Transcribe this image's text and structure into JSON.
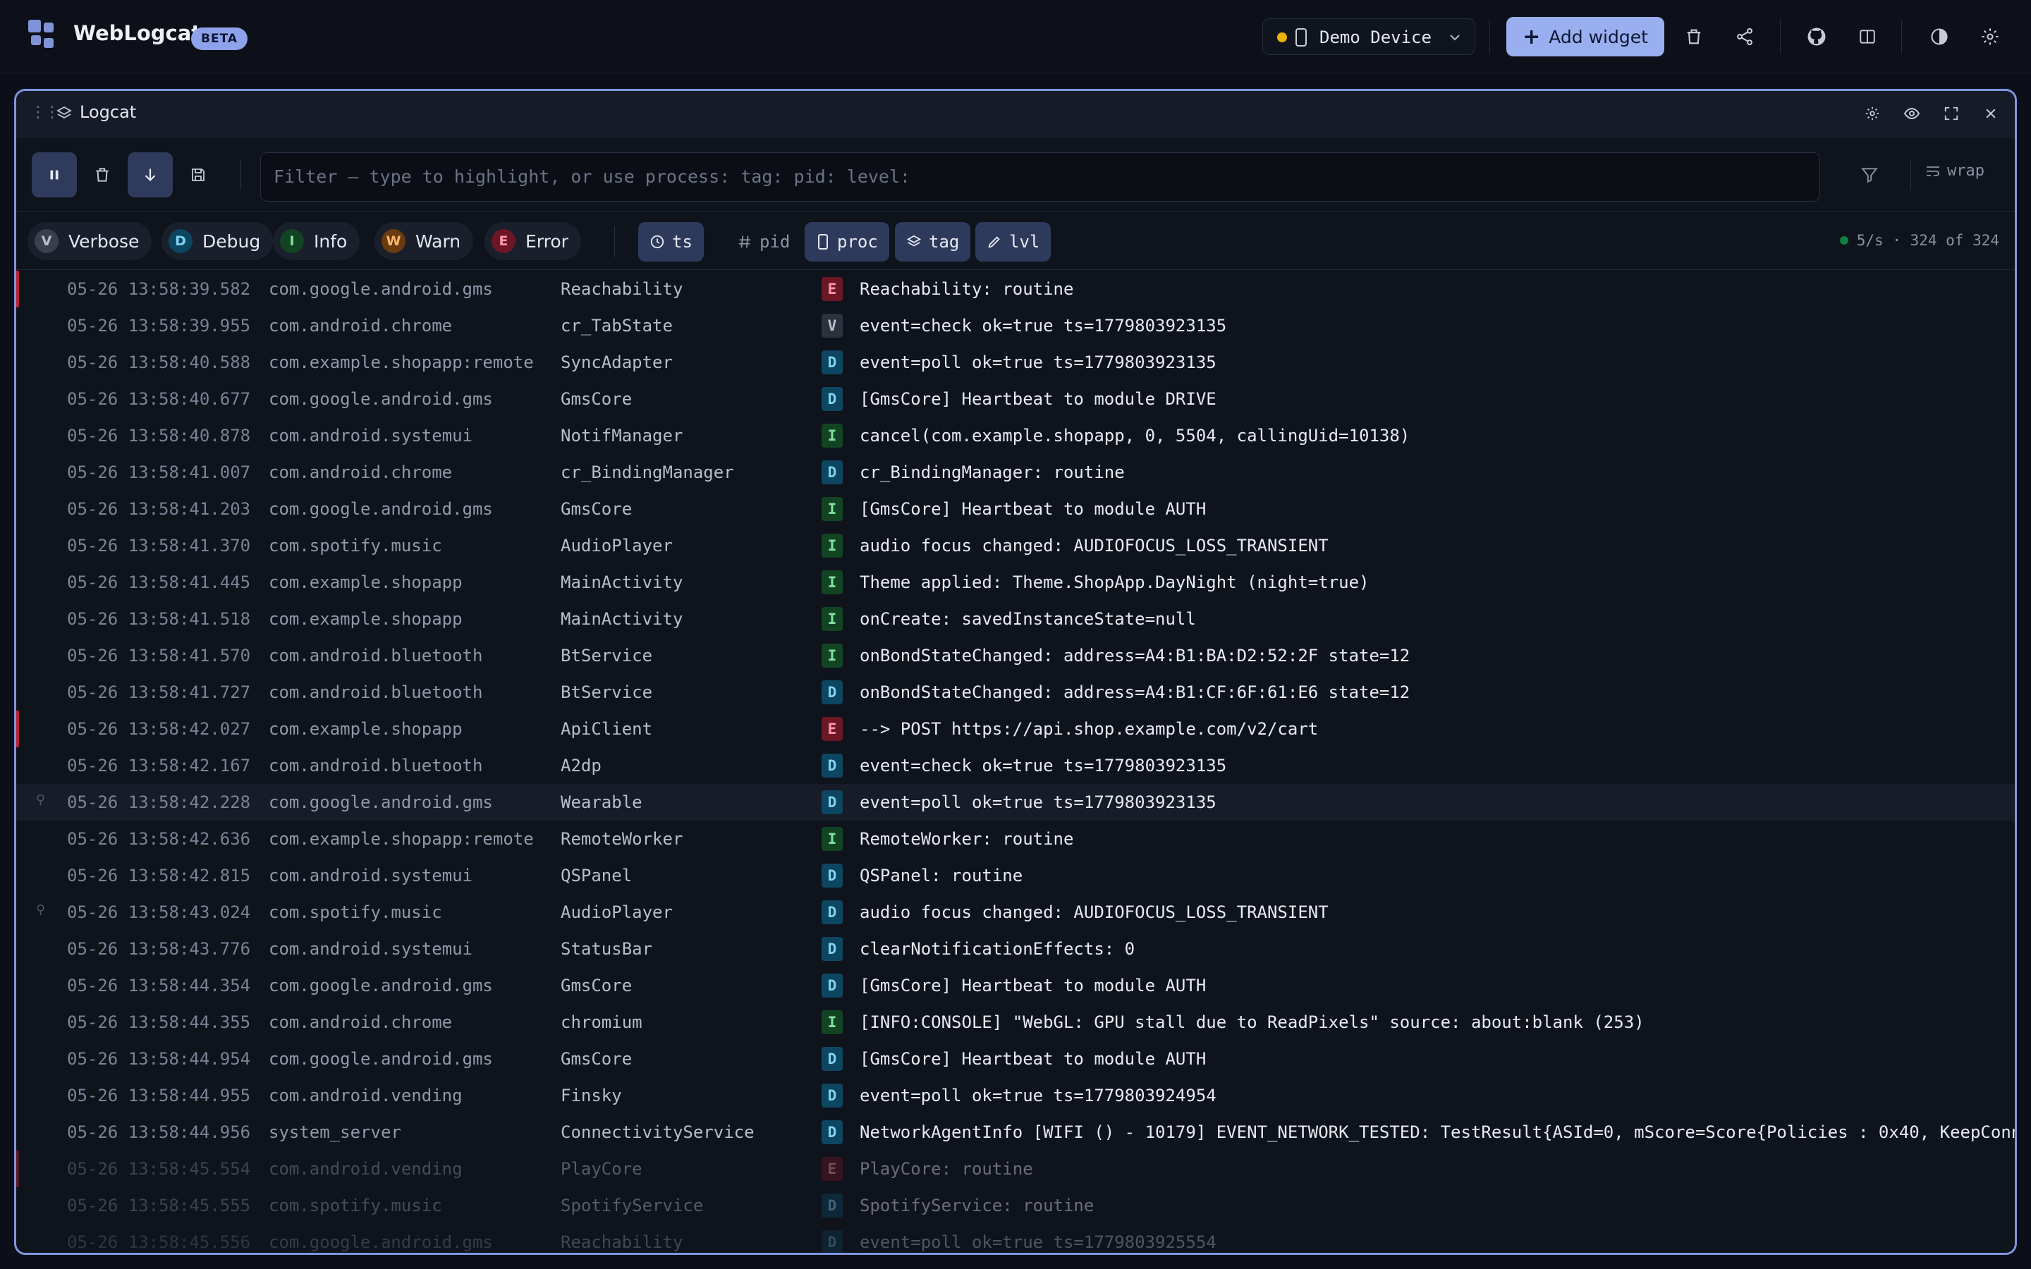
{
  "app": {
    "title": "WebLogcat",
    "badge": "BETA"
  },
  "header": {
    "device_label": "Demo Device",
    "add_widget_label": "Add widget",
    "icons": [
      "trash-icon",
      "share-icon",
      "github-icon",
      "layout-icon",
      "contrast-icon",
      "gear-icon"
    ]
  },
  "panel": {
    "title": "Logcat",
    "filter_placeholder": "Filter — type to highlight, or use  process:  tag:  pid:  level:",
    "wrap_label": "wrap",
    "levels": [
      {
        "letter": "V",
        "label": "Verbose"
      },
      {
        "letter": "D",
        "label": "Debug"
      },
      {
        "letter": "I",
        "label": "Info"
      },
      {
        "letter": "W",
        "label": "Warn"
      },
      {
        "letter": "E",
        "label": "Error"
      }
    ],
    "columns": [
      {
        "label": "ts",
        "active": true
      },
      {
        "label": "pid",
        "active": false
      },
      {
        "label": "proc",
        "active": true
      },
      {
        "label": "tag",
        "active": true
      },
      {
        "label": "lvl",
        "active": true
      }
    ],
    "rate": "5/s · 324 of 324"
  },
  "rows": [
    {
      "ts": "05-26 13:58:39.582",
      "proc": "com.google.android.gms",
      "tag": "Reachability",
      "lvl": "E",
      "msg": "Reachability: routine"
    },
    {
      "ts": "05-26 13:58:39.955",
      "proc": "com.android.chrome",
      "tag": "cr_TabState",
      "lvl": "V",
      "msg": "event=check ok=true ts=1779803923135"
    },
    {
      "ts": "05-26 13:58:40.588",
      "proc": "com.example.shopapp:remote",
      "tag": "SyncAdapter",
      "lvl": "D",
      "msg": "event=poll ok=true ts=1779803923135"
    },
    {
      "ts": "05-26 13:58:40.677",
      "proc": "com.google.android.gms",
      "tag": "GmsCore",
      "lvl": "D",
      "msg": "[GmsCore] Heartbeat to module DRIVE"
    },
    {
      "ts": "05-26 13:58:40.878",
      "proc": "com.android.systemui",
      "tag": "NotifManager",
      "lvl": "I",
      "msg": "cancel(com.example.shopapp, 0, 5504, callingUid=10138)"
    },
    {
      "ts": "05-26 13:58:41.007",
      "proc": "com.android.chrome",
      "tag": "cr_BindingManager",
      "lvl": "D",
      "msg": "cr_BindingManager: routine"
    },
    {
      "ts": "05-26 13:58:41.203",
      "proc": "com.google.android.gms",
      "tag": "GmsCore",
      "lvl": "I",
      "msg": "[GmsCore] Heartbeat to module AUTH"
    },
    {
      "ts": "05-26 13:58:41.370",
      "proc": "com.spotify.music",
      "tag": "AudioPlayer",
      "lvl": "I",
      "msg": "audio focus changed: AUDIOFOCUS_LOSS_TRANSIENT"
    },
    {
      "ts": "05-26 13:58:41.445",
      "proc": "com.example.shopapp",
      "tag": "MainActivity",
      "lvl": "I",
      "msg": "Theme applied: Theme.ShopApp.DayNight (night=true)"
    },
    {
      "ts": "05-26 13:58:41.518",
      "proc": "com.example.shopapp",
      "tag": "MainActivity",
      "lvl": "I",
      "msg": "onCreate: savedInstanceState=null"
    },
    {
      "ts": "05-26 13:58:41.570",
      "proc": "com.android.bluetooth",
      "tag": "BtService",
      "lvl": "I",
      "msg": "onBondStateChanged: address=A4:B1:BA:D2:52:2F state=12"
    },
    {
      "ts": "05-26 13:58:41.727",
      "proc": "com.android.bluetooth",
      "tag": "BtService",
      "lvl": "D",
      "msg": "onBondStateChanged: address=A4:B1:CF:6F:61:E6 state=12"
    },
    {
      "ts": "05-26 13:58:42.027",
      "proc": "com.example.shopapp",
      "tag": "ApiClient",
      "lvl": "E",
      "msg": "--> POST https://api.shop.example.com/v2/cart"
    },
    {
      "ts": "05-26 13:58:42.167",
      "proc": "com.android.bluetooth",
      "tag": "A2dp",
      "lvl": "D",
      "msg": "event=check ok=true ts=1779803923135"
    },
    {
      "ts": "05-26 13:58:42.228",
      "proc": "com.google.android.gms",
      "tag": "Wearable",
      "lvl": "D",
      "msg": "event=poll ok=true ts=1779803923135",
      "highlight": true,
      "pinned": true
    },
    {
      "ts": "05-26 13:58:42.636",
      "proc": "com.example.shopapp:remote",
      "tag": "RemoteWorker",
      "lvl": "I",
      "msg": "RemoteWorker: routine"
    },
    {
      "ts": "05-26 13:58:42.815",
      "proc": "com.android.systemui",
      "tag": "QSPanel",
      "lvl": "D",
      "msg": "QSPanel: routine"
    },
    {
      "ts": "05-26 13:58:43.024",
      "proc": "com.spotify.music",
      "tag": "AudioPlayer",
      "lvl": "D",
      "msg": "audio focus changed: AUDIOFOCUS_LOSS_TRANSIENT",
      "pinned": true
    },
    {
      "ts": "05-26 13:58:43.776",
      "proc": "com.android.systemui",
      "tag": "StatusBar",
      "lvl": "D",
      "msg": "clearNotificationEffects: 0"
    },
    {
      "ts": "05-26 13:58:44.354",
      "proc": "com.google.android.gms",
      "tag": "GmsCore",
      "lvl": "D",
      "msg": "[GmsCore] Heartbeat to module AUTH"
    },
    {
      "ts": "05-26 13:58:44.355",
      "proc": "com.android.chrome",
      "tag": "chromium",
      "lvl": "I",
      "msg": "[INFO:CONSOLE] \"WebGL: GPU stall due to ReadPixels\" source: about:blank (253)"
    },
    {
      "ts": "05-26 13:58:44.954",
      "proc": "com.google.android.gms",
      "tag": "GmsCore",
      "lvl": "D",
      "msg": "[GmsCore] Heartbeat to module AUTH"
    },
    {
      "ts": "05-26 13:58:44.955",
      "proc": "com.android.vending",
      "tag": "Finsky",
      "lvl": "D",
      "msg": "event=poll ok=true ts=1779803924954"
    },
    {
      "ts": "05-26 13:58:44.956",
      "proc": "system_server",
      "tag": "ConnectivityService",
      "lvl": "D",
      "msg": "NetworkAgentInfo [WIFI () - 10179] EVENT_NETWORK_TESTED: TestResult{ASId=0, mScore=Score{Policies : 0x40, KeepConn"
    },
    {
      "ts": "05-26 13:58:45.554",
      "proc": "com.android.vending",
      "tag": "PlayCore",
      "lvl": "E",
      "msg": "PlayCore: routine",
      "dim": 1
    },
    {
      "ts": "05-26 13:58:45.555",
      "proc": "com.spotify.music",
      "tag": "SpotifyService",
      "lvl": "D",
      "msg": "SpotifyService: routine",
      "dim": 1
    },
    {
      "ts": "05-26 13:58:45.556",
      "proc": "com.google.android.gms",
      "tag": "Reachability",
      "lvl": "D",
      "msg": "event=poll ok=true ts=1779803925554",
      "dim": 2
    }
  ]
}
